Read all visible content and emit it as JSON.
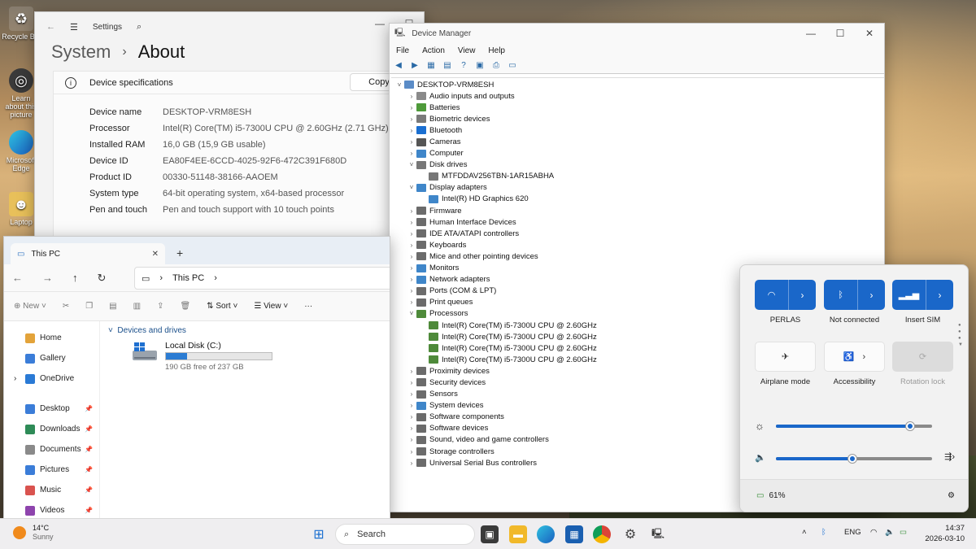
{
  "desktop": {
    "icons": [
      {
        "label": "Recycle Bin",
        "icon": "recycle-bin-icon"
      },
      {
        "label": "Learn about this picture",
        "icon": "learn-icon"
      },
      {
        "label": "Microsoft Edge",
        "icon": "edge-icon"
      },
      {
        "label": "Laptop",
        "icon": "laptop-user-icon"
      }
    ]
  },
  "settings": {
    "window_title": "Settings",
    "breadcrumb_parent": "System",
    "breadcrumb_sep": "›",
    "page_title": "About",
    "section_title": "Device specifications",
    "copy_label": "Copy",
    "specs": [
      {
        "key": "Device name",
        "value": "DESKTOP-VRM8ESH"
      },
      {
        "key": "Processor",
        "value": "Intel(R) Core(TM) i5-7300U CPU @ 2.60GHz (2.71 GHz)"
      },
      {
        "key": "Installed RAM",
        "value": "16,0 GB (15,9 GB usable)"
      },
      {
        "key": "Device ID",
        "value": "EA80F4EE-6CCD-4025-92F6-472C391F680D"
      },
      {
        "key": "Product ID",
        "value": "00330-51148-38166-AAOEM"
      },
      {
        "key": "System type",
        "value": "64-bit operating system, x64-based processor"
      },
      {
        "key": "Pen and touch",
        "value": "Pen and touch support with 10 touch points"
      }
    ]
  },
  "devmgr": {
    "title": "Device Manager",
    "menu": [
      "File",
      "Action",
      "View",
      "Help"
    ],
    "tree": [
      {
        "label": "DESKTOP-VRM8ESH",
        "level": 0,
        "exp": "v",
        "color": "#5b8cc7"
      },
      {
        "label": "Audio inputs and outputs",
        "level": 1,
        "exp": ">",
        "color": "#8a8a8a"
      },
      {
        "label": "Batteries",
        "level": 1,
        "exp": ">",
        "color": "#4e9a3a"
      },
      {
        "label": "Biometric devices",
        "level": 1,
        "exp": ">",
        "color": "#7a7a7a"
      },
      {
        "label": "Bluetooth",
        "level": 1,
        "exp": ">",
        "color": "#1a6fd1"
      },
      {
        "label": "Cameras",
        "level": 1,
        "exp": ">",
        "color": "#555555"
      },
      {
        "label": "Computer",
        "level": 1,
        "exp": ">",
        "color": "#3f86c9"
      },
      {
        "label": "Disk drives",
        "level": 1,
        "exp": "v",
        "color": "#777777"
      },
      {
        "label": "MTFDDAV256TBN-1AR15ABHA",
        "level": 2,
        "exp": "",
        "color": "#777777"
      },
      {
        "label": "Display adapters",
        "level": 1,
        "exp": "v",
        "color": "#3f86c9"
      },
      {
        "label": "Intel(R) HD Graphics 620",
        "level": 2,
        "exp": "",
        "color": "#3f86c9"
      },
      {
        "label": "Firmware",
        "level": 1,
        "exp": ">",
        "color": "#6b6b6b"
      },
      {
        "label": "Human Interface Devices",
        "level": 1,
        "exp": ">",
        "color": "#6b6b6b"
      },
      {
        "label": "IDE ATA/ATAPI controllers",
        "level": 1,
        "exp": ">",
        "color": "#6b6b6b"
      },
      {
        "label": "Keyboards",
        "level": 1,
        "exp": ">",
        "color": "#6b6b6b"
      },
      {
        "label": "Mice and other pointing devices",
        "level": 1,
        "exp": ">",
        "color": "#6b6b6b"
      },
      {
        "label": "Monitors",
        "level": 1,
        "exp": ">",
        "color": "#3f86c9"
      },
      {
        "label": "Network adapters",
        "level": 1,
        "exp": ">",
        "color": "#3f86c9"
      },
      {
        "label": "Ports (COM & LPT)",
        "level": 1,
        "exp": ">",
        "color": "#6b6b6b"
      },
      {
        "label": "Print queues",
        "level": 1,
        "exp": ">",
        "color": "#6b6b6b"
      },
      {
        "label": "Processors",
        "level": 1,
        "exp": "v",
        "color": "#4e8a3a"
      },
      {
        "label": "Intel(R) Core(TM) i5-7300U CPU @ 2.60GHz",
        "level": 2,
        "exp": "",
        "color": "#4e8a3a"
      },
      {
        "label": "Intel(R) Core(TM) i5-7300U CPU @ 2.60GHz",
        "level": 2,
        "exp": "",
        "color": "#4e8a3a"
      },
      {
        "label": "Intel(R) Core(TM) i5-7300U CPU @ 2.60GHz",
        "level": 2,
        "exp": "",
        "color": "#4e8a3a"
      },
      {
        "label": "Intel(R) Core(TM) i5-7300U CPU @ 2.60GHz",
        "level": 2,
        "exp": "",
        "color": "#4e8a3a"
      },
      {
        "label": "Proximity devices",
        "level": 1,
        "exp": ">",
        "color": "#6b6b6b"
      },
      {
        "label": "Security devices",
        "level": 1,
        "exp": ">",
        "color": "#6b6b6b"
      },
      {
        "label": "Sensors",
        "level": 1,
        "exp": ">",
        "color": "#6b6b6b"
      },
      {
        "label": "System devices",
        "level": 1,
        "exp": ">",
        "color": "#3f86c9"
      },
      {
        "label": "Software components",
        "level": 1,
        "exp": ">",
        "color": "#6b6b6b"
      },
      {
        "label": "Software devices",
        "level": 1,
        "exp": ">",
        "color": "#6b6b6b"
      },
      {
        "label": "Sound, video and game controllers",
        "level": 1,
        "exp": ">",
        "color": "#6b6b6b"
      },
      {
        "label": "Storage controllers",
        "level": 1,
        "exp": ">",
        "color": "#6b6b6b"
      },
      {
        "label": "Universal Serial Bus controllers",
        "level": 1,
        "exp": ">",
        "color": "#6b6b6b"
      }
    ]
  },
  "explorer": {
    "tab_title": "This PC",
    "path": "This PC",
    "commands": {
      "new": "New",
      "sort": "Sort",
      "view": "View"
    },
    "nav": [
      {
        "label": "Home",
        "pin": false,
        "color": "#e3a33a"
      },
      {
        "label": "Gallery",
        "pin": false,
        "color": "#3b7dd8"
      },
      {
        "label": "OneDrive",
        "pin": false,
        "color": "#2a7ad5"
      },
      {
        "label": "Desktop",
        "pin": true,
        "color": "#3b7dd8"
      },
      {
        "label": "Downloads",
        "pin": true,
        "color": "#2e8b57"
      },
      {
        "label": "Documents",
        "pin": true,
        "color": "#8a8a8a"
      },
      {
        "label": "Pictures",
        "pin": true,
        "color": "#3b7dd8"
      },
      {
        "label": "Music",
        "pin": true,
        "color": "#d9534f"
      },
      {
        "label": "Videos",
        "pin": true,
        "color": "#8e44ad"
      }
    ],
    "group_label": "Devices and drives",
    "drive": {
      "name": "Local Disk (C:)",
      "free_text": "190 GB free of 237 GB",
      "used_fraction": 0.2
    }
  },
  "quick": {
    "tiles_row1": [
      {
        "label": "PERLAS",
        "icon": "wifi-icon"
      },
      {
        "label": "Not connected",
        "icon": "bluetooth-icon"
      },
      {
        "label": "Insert SIM",
        "icon": "cellular-icon"
      }
    ],
    "tiles_row2": [
      {
        "label": "Airplane mode",
        "icon": "airplane-icon"
      },
      {
        "label": "Accessibility",
        "icon": "accessibility-icon"
      },
      {
        "label": "Rotation lock",
        "icon": "rotation-lock-icon"
      }
    ],
    "brightness": 0.86,
    "volume": 0.49,
    "battery": "61%"
  },
  "taskbar": {
    "weather_temp": "14°C",
    "weather_cond": "Sunny",
    "search_placeholder": "Search",
    "lang": "ENG",
    "time": "14:37",
    "date": "2026-03-10"
  }
}
